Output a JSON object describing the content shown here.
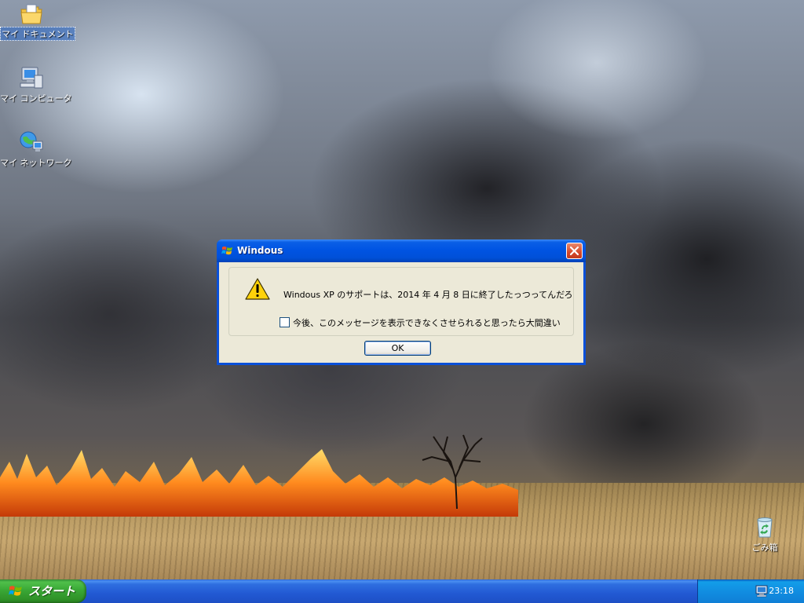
{
  "desktop": {
    "icons": [
      {
        "label": "マイ ドキュメント",
        "icon": "my-documents-folder-icon"
      },
      {
        "label": "マイ コンピュータ",
        "icon": "my-computer-icon"
      },
      {
        "label": "マイ ネットワーク",
        "icon": "my-network-icon"
      },
      {
        "label": "ごみ箱",
        "icon": "recycle-bin-icon"
      }
    ]
  },
  "dialog": {
    "title": "Windous",
    "message": "Windous XP のサポートは、2014 年 4 月 8 日に終了したっつってんだろ",
    "checkbox_label": "今後、このメッセージを表示できなくさせられると思ったら大間違い",
    "checkbox_checked": false,
    "ok_label": "OK",
    "icon": "warning-icon"
  },
  "taskbar": {
    "start_label": "スタート",
    "tray_icons": [
      "keyboard-icon",
      "security-alert-icon",
      "network-icon"
    ],
    "clock": "23:18"
  },
  "colors": {
    "title_bar": "#0054e3",
    "taskbar": "#245edb",
    "start_button": "#3aa836",
    "dialog_face": "#ece9d8"
  }
}
